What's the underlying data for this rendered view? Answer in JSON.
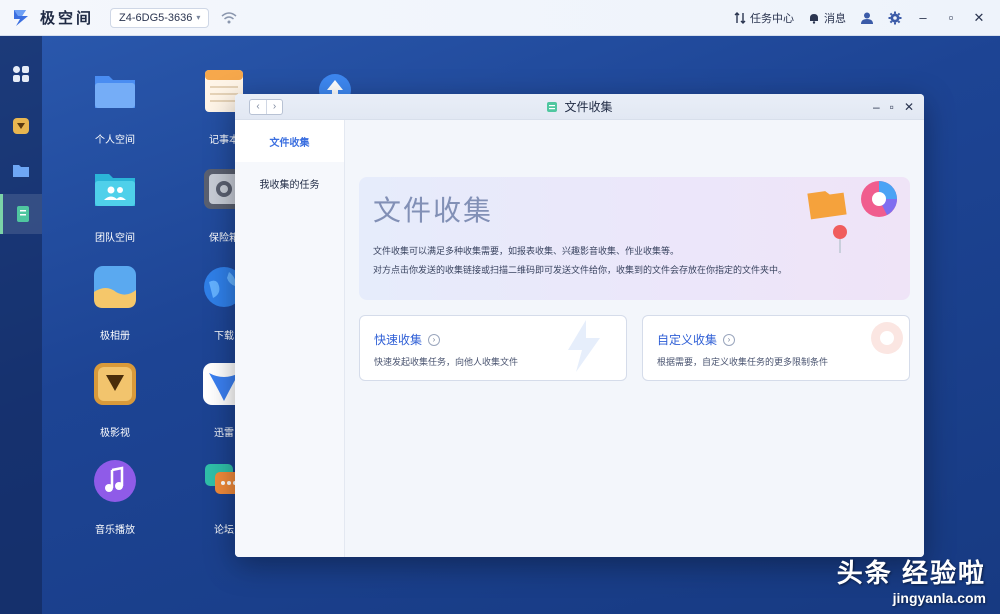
{
  "topbar": {
    "app_name": "极空间",
    "device": "Z4-6DG5-3636",
    "tasks": "任务中心",
    "messages": "消息"
  },
  "desktop_icons": [
    {
      "label": "个人空间",
      "icon": "folder-icon"
    },
    {
      "label": "记事本",
      "icon": "notepad-icon"
    },
    {
      "label": "团队空间",
      "icon": "team-folder-icon"
    },
    {
      "label": "保险箱",
      "icon": "safe-icon"
    },
    {
      "label": "极相册",
      "icon": "album-icon"
    },
    {
      "label": "下载",
      "icon": "globe-download-icon"
    },
    {
      "label": "极影视",
      "icon": "video-icon"
    },
    {
      "label": "迅雷",
      "icon": "thunder-icon"
    },
    {
      "label": "音乐播放",
      "icon": "music-icon"
    },
    {
      "label": "论坛",
      "icon": "forum-icon"
    }
  ],
  "window": {
    "title": "文件收集",
    "sidenav": [
      "文件收集",
      "我收集的任务"
    ],
    "hero": {
      "title": "文件收集",
      "desc1": "文件收集可以满足多种收集需要，如报表收集、兴趣影音收集、作业收集等。",
      "desc2": "对方点击你发送的收集链接或扫描二维码即可发送文件给你，收集到的文件会存放在你指定的文件夹中。"
    },
    "cards": [
      {
        "title": "快速收集",
        "desc": "快速发起收集任务，向他人收集文件"
      },
      {
        "title": "自定义收集",
        "desc": "根据需要，自定义收集任务的更多限制条件"
      }
    ]
  },
  "watermark": {
    "line1": "头条 经验啦",
    "line2": "jingyanla.com"
  },
  "colors": {
    "accent": "#3b6fe0",
    "desktop_bg": "#1d4494",
    "window_bg": "#f2f5fb"
  }
}
